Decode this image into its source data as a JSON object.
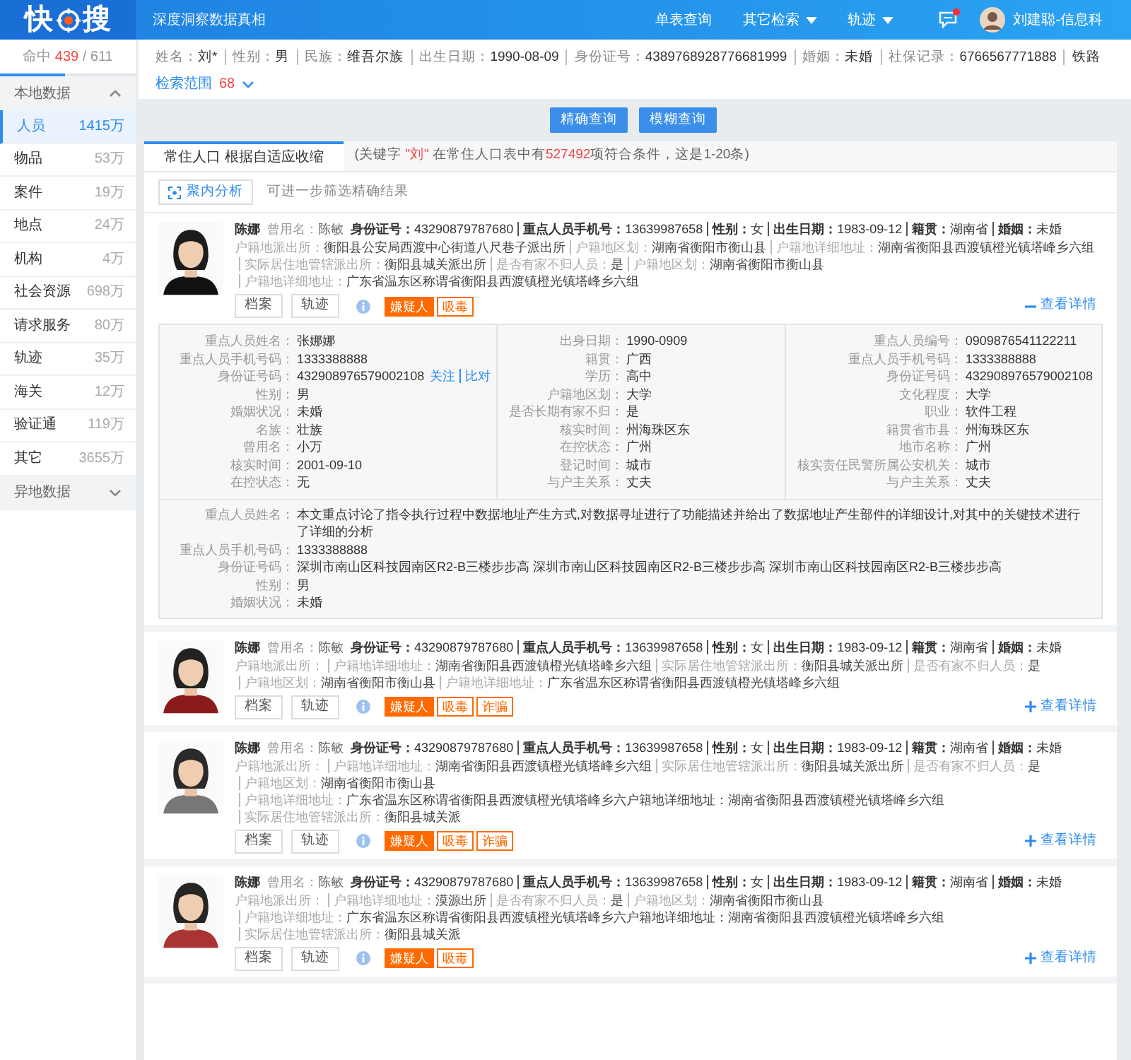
{
  "header": {
    "logo_left": "快",
    "logo_right": "搜",
    "subtitle": "深度洞察数据真相",
    "nav": [
      {
        "label": "单表查询",
        "dropdown": false
      },
      {
        "label": "其它检索",
        "dropdown": true
      },
      {
        "label": "轨迹",
        "dropdown": true
      }
    ],
    "notification": {
      "unread": true
    },
    "user": "刘建聪-信息科"
  },
  "sidebar": {
    "hits": {
      "label": "命中",
      "count": "439",
      "total": "/ 611"
    },
    "groups": [
      {
        "title": "本地数据",
        "expanded": true,
        "items": [
          {
            "label": "人员",
            "count": "1415万",
            "selected": true
          },
          {
            "label": "物品",
            "count": "53万",
            "selected": false
          },
          {
            "label": "案件",
            "count": "19万",
            "selected": false
          },
          {
            "label": "地点",
            "count": "24万",
            "selected": false
          },
          {
            "label": "机构",
            "count": "4万",
            "selected": false
          },
          {
            "label": "社会资源",
            "count": "698万",
            "selected": false
          },
          {
            "label": "请求服务",
            "count": "80万",
            "selected": false
          },
          {
            "label": "轨迹",
            "count": "35万",
            "selected": false
          },
          {
            "label": "海关",
            "count": "12万",
            "selected": false
          },
          {
            "label": "验证通",
            "count": "119万",
            "selected": false
          },
          {
            "label": "其它",
            "count": "3655万",
            "selected": false
          }
        ]
      },
      {
        "title": "异地数据",
        "expanded": false
      }
    ]
  },
  "criteria": {
    "fields": [
      {
        "label": "姓名：",
        "value": "刘*"
      },
      {
        "label": "性别：",
        "value": "男"
      },
      {
        "label": "民族：",
        "value": "维吾尔族"
      },
      {
        "label": "出生日期：",
        "value": "1990-08-09"
      },
      {
        "label": "身份证号：",
        "value": "4389768928776681999"
      },
      {
        "label": "婚姻：",
        "value": "未婚"
      },
      {
        "label": "社保记录：",
        "value": "6766567771888"
      },
      {
        "value": "铁路"
      }
    ],
    "scope": {
      "label": "检索范围",
      "count": "68"
    }
  },
  "query_buttons": [
    "精确查询",
    "模糊查询"
  ],
  "tabs": [
    {
      "label": "常住人口 根据自适应收缩",
      "selected": true
    }
  ],
  "result_info": [
    {
      "text": "(关键字 ",
      "highlight": false
    },
    {
      "text": "\"刘\"",
      "highlight": true
    },
    {
      "text": " 在常住人口表中有",
      "highlight": false
    },
    {
      "text": "527492",
      "highlight": true
    },
    {
      "text": "项符合条件，这是1-20条)",
      "highlight": false
    }
  ],
  "analysis_button": "聚内分析",
  "analysis_hint": "可进一步筛选精确结果",
  "results": [
    {
      "name": "陈娜",
      "alias": {
        "label": "曾用名：",
        "value": "陈敏"
      },
      "main": [
        {
          "label": "身份证号：",
          "value": "43290879787680"
        },
        {
          "label": "重点人员手机号：",
          "value": "13639987658"
        },
        {
          "label": "性别：",
          "value": "女"
        },
        {
          "label": "出生日期：",
          "value": "1983-09-12"
        },
        {
          "label": "籍贯：",
          "value": "湖南省"
        },
        {
          "label": "婚姻：",
          "value": "未婚"
        }
      ],
      "details": [
        {
          "label": "户籍地派出所：",
          "value": "衡阳县公安局西渡中心街道八尺巷子派出所"
        },
        {
          "label": "户籍地区划：",
          "value": "湖南省衡阳市衡山县"
        },
        {
          "label": "户籍地详细地址：",
          "value": "湖南省衡阳县西渡镇橙光镇塔峰乡六组"
        },
        {
          "label": "实际居住地管辖派出所：",
          "value": "衡阳县城关派出所"
        },
        {
          "label": "是否有家不归人员：",
          "value": "是"
        },
        {
          "label": "户籍地区划：",
          "value": "湖南省衡阳市衡山县"
        },
        {
          "label": "户籍地详细地址：",
          "value": "广东省温东区称谓省衡阳县西渡镇橙光镇塔峰乡六组"
        }
      ],
      "buttons": [
        "档案",
        "轨迹"
      ],
      "tags": [
        {
          "label": "嫌疑人",
          "kind": "filled"
        },
        {
          "label": "吸毒",
          "kind": "outline"
        }
      ],
      "toggle": {
        "label": "查看详情",
        "expanded": true
      },
      "detail_panel": {
        "columns": [
          [
            {
              "label": "重点人员姓名：",
              "value": "张娜娜"
            },
            {
              "label": "重点人员手机号码：",
              "value": "1333388888"
            },
            {
              "label": "身份证号码：",
              "value": "432908976579002108",
              "links": [
                "关注",
                "比对"
              ]
            },
            {
              "label": "性别：",
              "value": "男"
            },
            {
              "label": "婚姻状况：",
              "value": "未婚"
            },
            {
              "label": "名族：",
              "value": "壮族"
            },
            {
              "label": "曾用名：",
              "value": "小万"
            },
            {
              "label": "核实时间：",
              "value": "2001-09-10"
            },
            {
              "label": "在控状态：",
              "value": "无"
            }
          ],
          [
            {
              "label": "出身日期：",
              "value": "1990-0909"
            },
            {
              "label": "籍贯：",
              "value": "广西"
            },
            {
              "label": "学历：",
              "value": "高中"
            },
            {
              "label": "户籍地区划：",
              "value": "大学"
            },
            {
              "label": "是否长期有家不归：",
              "value": "是"
            },
            {
              "label": "核实时间：",
              "value": "州海珠区东"
            },
            {
              "label": "在控状态：",
              "value": "广州"
            },
            {
              "label": "登记时间：",
              "value": "城市"
            },
            {
              "label": "与户主关系：",
              "value": "丈夫"
            }
          ],
          [
            {
              "label": "重点人员编号：",
              "value": "0909876541122211"
            },
            {
              "label": "重点人员手机号码：",
              "value": "1333388888"
            },
            {
              "label": "身份证号码：",
              "value": "432908976579002108"
            },
            {
              "label": "文化程度：",
              "value": "大学"
            },
            {
              "label": "职业：",
              "value": "软件工程"
            },
            {
              "label": "籍贯省市县：",
              "value": "州海珠区东"
            },
            {
              "label": "地市名称：",
              "value": "广州"
            },
            {
              "label": "核实责任民警所属公安机关：",
              "value": "城市"
            },
            {
              "label": "与户主关系：",
              "value": "丈夫"
            }
          ]
        ],
        "extra": [
          {
            "label": "重点人员姓名：",
            "value": "本文重点讨论了指令执行过程中数据地址产生方式,对数据寻址进行了功能描述并给出了数据地址产生部件的详细设计,对其中的关键技术进行了详细的分析"
          },
          {
            "label": "重点人员手机号码：",
            "value": "1333388888"
          },
          {
            "label": "身份证号码：",
            "value": "深圳市南山区科技园南区R2-B三楼步步高 深圳市南山区科技园南区R2-B三楼步步高 深圳市南山区科技园南区R2-B三楼步步高"
          },
          {
            "label": "性别：",
            "value": "男"
          },
          {
            "label": "婚姻状况：",
            "value": "未婚"
          }
        ]
      }
    },
    {
      "name": "陈娜",
      "alias": {
        "label": "曾用名：",
        "value": "陈敏"
      },
      "main": [
        {
          "label": "身份证号：",
          "value": "43290879787680"
        },
        {
          "label": "重点人员手机号：",
          "value": "13639987658"
        },
        {
          "label": "性别：",
          "value": "女"
        },
        {
          "label": "出生日期：",
          "value": "1983-09-12"
        },
        {
          "label": "籍贯：",
          "value": "湖南省"
        },
        {
          "label": "婚姻：",
          "value": "未婚"
        }
      ],
      "details": [
        {
          "label": "户籍地派出所："
        },
        {
          "label": "户籍地详细地址：",
          "value": "湖南省衡阳县西渡镇橙光镇塔峰乡六组"
        },
        {
          "label": "实际居住地管辖派出所：",
          "value": "衡阳县城关派出所"
        },
        {
          "label": "是否有家不归人员：",
          "value": "是"
        },
        {
          "label": "户籍地区划：",
          "value": "湖南省衡阳市衡山县"
        },
        {
          "label": "户籍地详细地址：",
          "value": "广东省温东区称谓省衡阳县西渡镇橙光镇塔峰乡六组"
        }
      ],
      "buttons": [
        "档案",
        "轨迹"
      ],
      "tags": [
        {
          "label": "嫌疑人",
          "kind": "filled"
        },
        {
          "label": "吸毒",
          "kind": "outline"
        },
        {
          "label": "诈骗",
          "kind": "outline"
        }
      ],
      "toggle": {
        "label": "查看详情",
        "expanded": false
      }
    },
    {
      "name": "陈娜",
      "alias": {
        "label": "曾用名：",
        "value": "陈敏"
      },
      "main": [
        {
          "label": "身份证号：",
          "value": "43290879787680"
        },
        {
          "label": "重点人员手机号：",
          "value": "13639987658"
        },
        {
          "label": "性别：",
          "value": "女"
        },
        {
          "label": "出生日期：",
          "value": "1983-09-12"
        },
        {
          "label": "籍贯：",
          "value": "湖南省"
        },
        {
          "label": "婚姻：",
          "value": "未婚"
        }
      ],
      "details": [
        {
          "label": "户籍地派出所："
        },
        {
          "label": "户籍地详细地址：",
          "value": "湖南省衡阳县西渡镇橙光镇塔峰乡六组"
        },
        {
          "label": "实际居住地管辖派出所：",
          "value": "衡阳县城关派出所"
        },
        {
          "label": "是否有家不归人员：",
          "value": "是"
        },
        {
          "label": "户籍地区划：",
          "value": "湖南省衡阳市衡山县"
        },
        {
          "label": "户籍地详细地址：",
          "value": "广东省温东区称谓省衡阳县西渡镇橙光镇塔峰乡六户籍地详细地址：湖南省衡阳县西渡镇橙光镇塔峰乡六组"
        },
        {
          "label": "实际居住地管辖派出所：",
          "value": "衡阳县城关派"
        }
      ],
      "buttons": [
        "档案",
        "轨迹"
      ],
      "tags": [
        {
          "label": "嫌疑人",
          "kind": "filled"
        },
        {
          "label": "吸毒",
          "kind": "outline"
        },
        {
          "label": "诈骗",
          "kind": "outline"
        }
      ],
      "toggle": {
        "label": "查看详情",
        "expanded": false
      }
    },
    {
      "name": "陈娜",
      "alias": {
        "label": "曾用名：",
        "value": "陈敏"
      },
      "main": [
        {
          "label": "身份证号：",
          "value": "43290879787680"
        },
        {
          "label": "重点人员手机号：",
          "value": "13639987658"
        },
        {
          "label": "性别：",
          "value": "女"
        },
        {
          "label": "出生日期：",
          "value": "1983-09-12"
        },
        {
          "label": "籍贯：",
          "value": "湖南省"
        },
        {
          "label": "婚姻：",
          "value": "未婚"
        }
      ],
      "details": [
        {
          "label": "户籍地派出所："
        },
        {
          "label": "户籍地详细地址：",
          "value": "漠源出所"
        },
        {
          "label": "是否有家不归人员：",
          "value": "是"
        },
        {
          "label": "户籍地区划：",
          "value": "湖南省衡阳市衡山县"
        },
        {
          "label": "户籍地详细地址：",
          "value": "广东省温东区称谓省衡阳县西渡镇橙光镇塔峰乡六户籍地详细地址：湖南省衡阳县西渡镇橙光镇塔峰乡六组"
        },
        {
          "label": "实际居住地管辖派出所：",
          "value": "衡阳县城关派"
        }
      ],
      "buttons": [
        "档案",
        "轨迹"
      ],
      "tags": [
        {
          "label": "嫌疑人",
          "kind": "filled"
        },
        {
          "label": "吸毒",
          "kind": "outline"
        }
      ],
      "toggle": {
        "label": "查看详情",
        "expanded": false
      }
    }
  ]
}
